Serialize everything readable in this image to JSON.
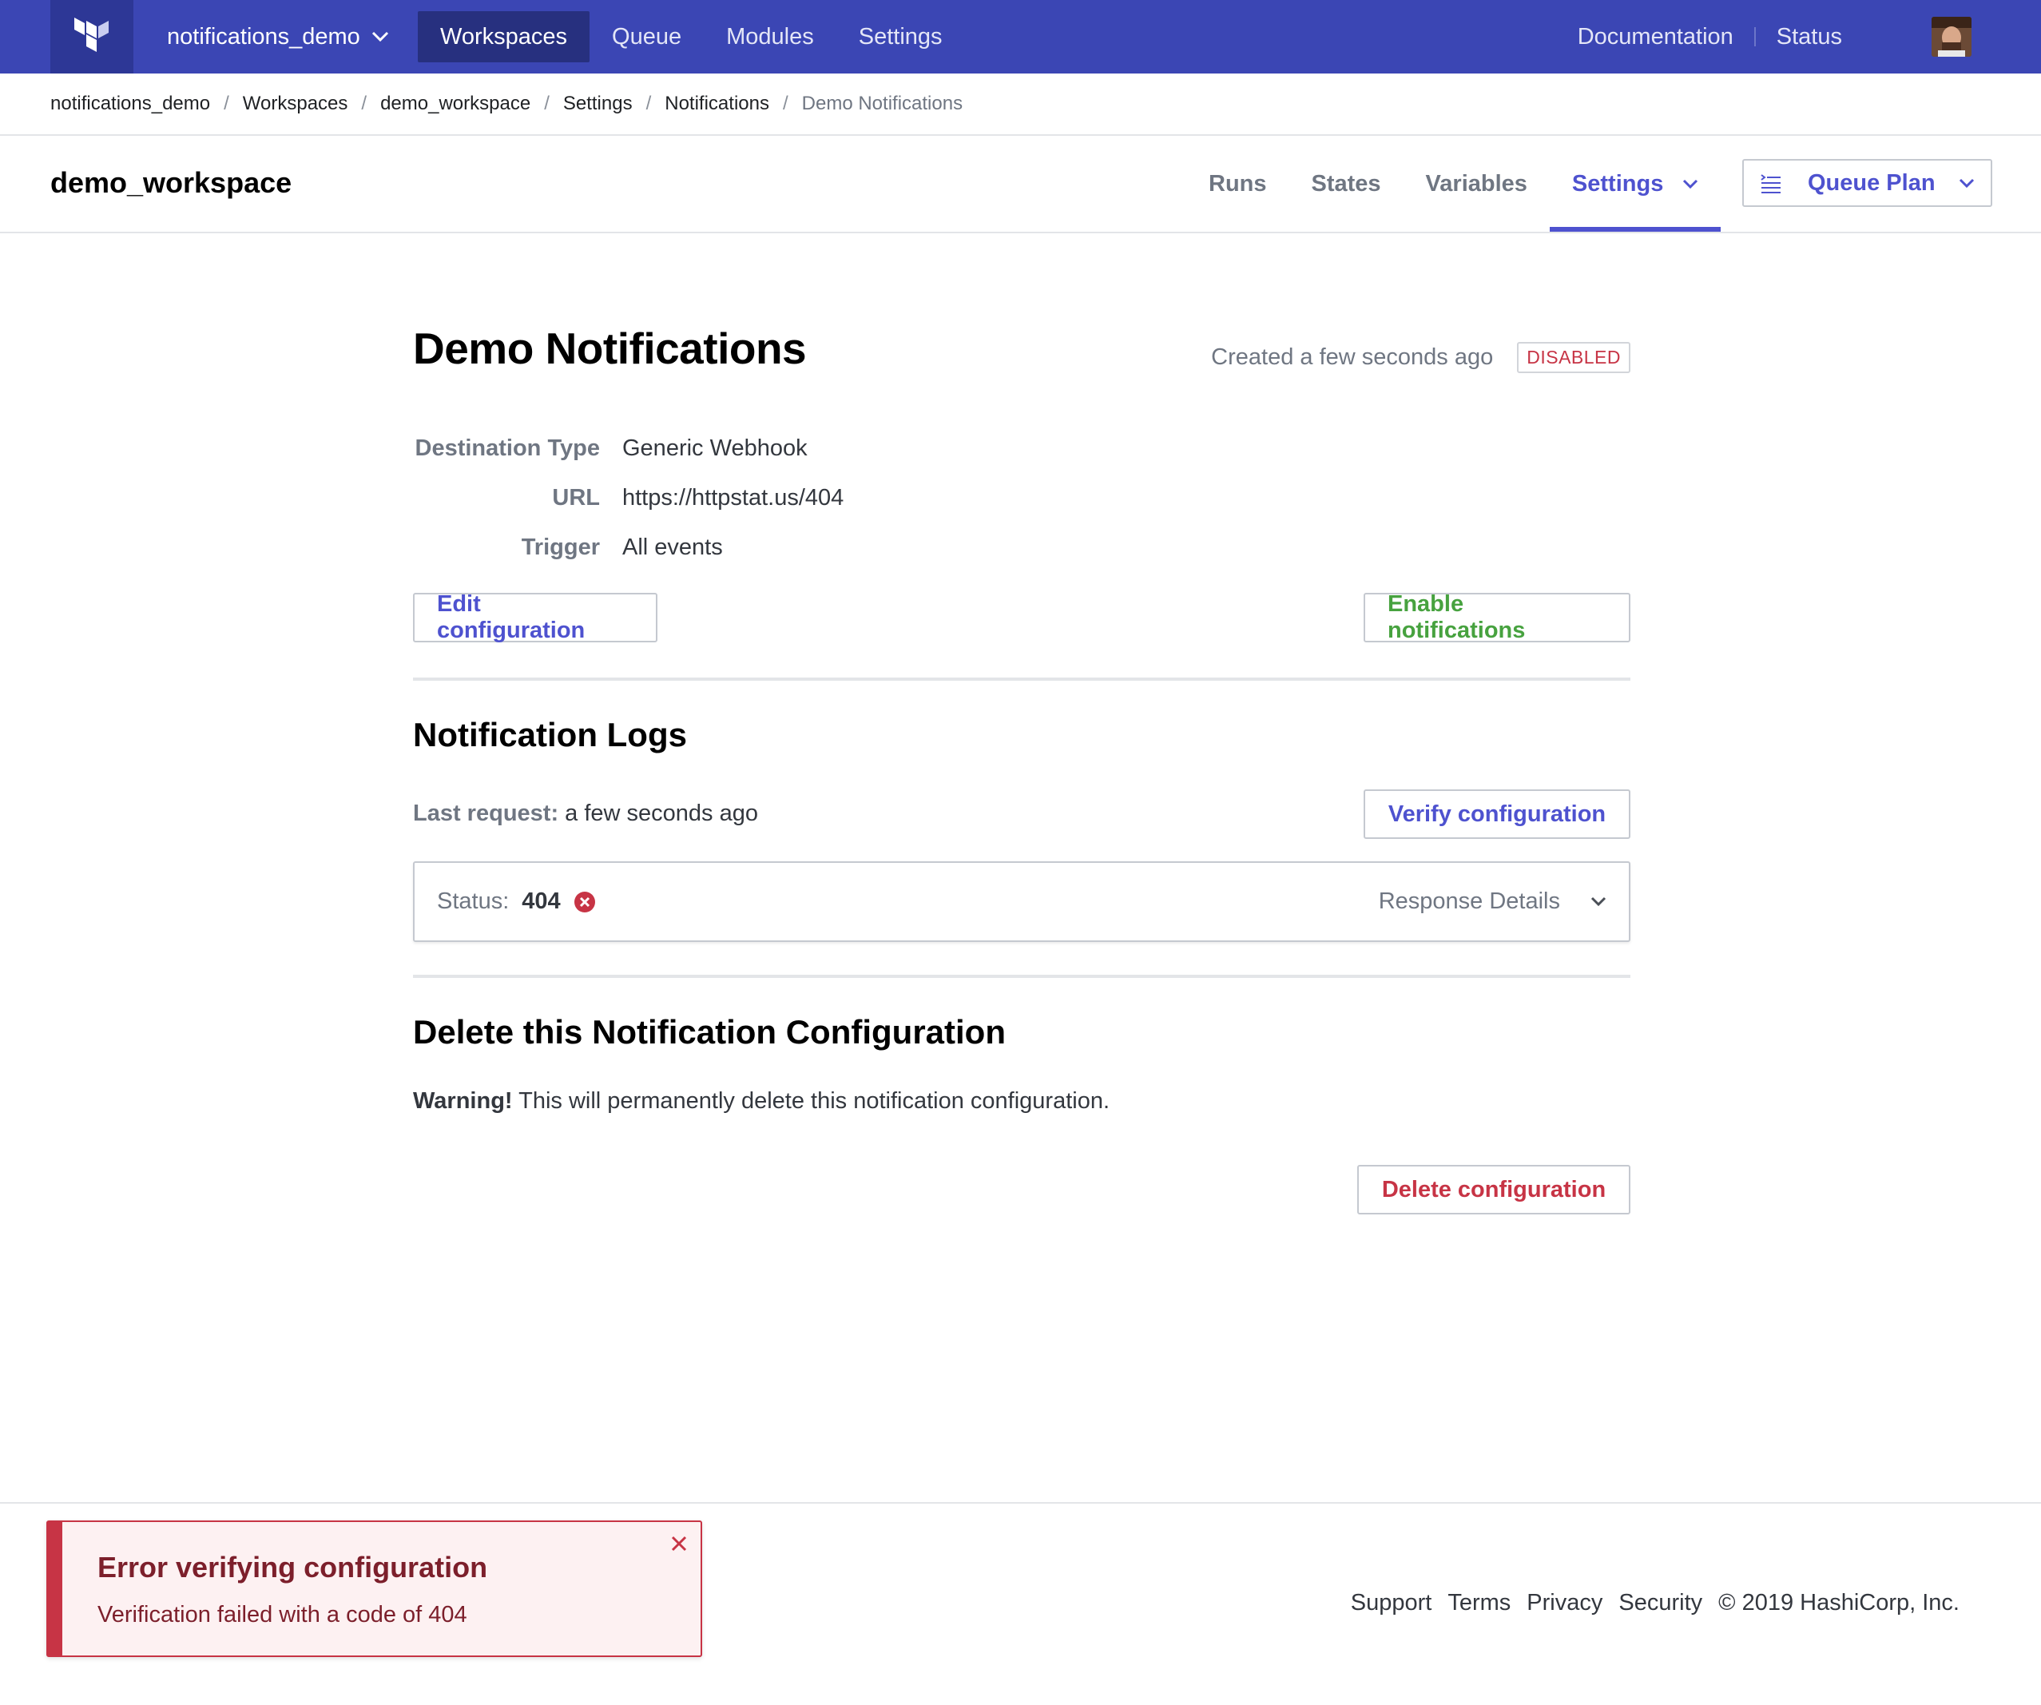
{
  "topnav": {
    "org": "notifications_demo",
    "links": [
      {
        "label": "Workspaces"
      },
      {
        "label": "Queue"
      },
      {
        "label": "Modules"
      },
      {
        "label": "Settings"
      }
    ],
    "documentation": "Documentation",
    "status": "Status"
  },
  "breadcrumb": [
    {
      "label": "notifications_demo"
    },
    {
      "label": "Workspaces"
    },
    {
      "label": "demo_workspace"
    },
    {
      "label": "Settings"
    },
    {
      "label": "Notifications"
    },
    {
      "label": "Demo Notifications"
    }
  ],
  "workspace": {
    "title": "demo_workspace",
    "tabs": [
      {
        "label": "Runs"
      },
      {
        "label": "States"
      },
      {
        "label": "Variables"
      },
      {
        "label": "Settings"
      }
    ],
    "queue_plan": "Queue Plan"
  },
  "notification": {
    "title": "Demo Notifications",
    "created": "Created a few seconds ago",
    "badge": "DISABLED",
    "details": [
      {
        "label": "Destination Type",
        "value": "Generic Webhook"
      },
      {
        "label": "URL",
        "value": "https://httpstat.us/404"
      },
      {
        "label": "Trigger",
        "value": "All events"
      }
    ],
    "edit_button": "Edit configuration",
    "enable_button": "Enable notifications"
  },
  "logs": {
    "title": "Notification Logs",
    "last_request_label": "Last request:",
    "last_request_value": "a few seconds ago",
    "verify_button": "Verify configuration",
    "status_label": "Status:",
    "status_code": "404",
    "response_details": "Response Details"
  },
  "delete": {
    "title": "Delete this Notification Configuration",
    "warning_label": "Warning!",
    "warning_text": "This will permanently delete this notification configuration.",
    "button": "Delete configuration"
  },
  "footer": {
    "links": [
      "Support",
      "Terms",
      "Privacy",
      "Security"
    ],
    "copyright": "© 2019 HashiCorp, Inc."
  },
  "toast": {
    "title": "Error verifying configuration",
    "message": "Verification failed with a code of 404"
  },
  "colors": {
    "nav_bg": "#3b46b4",
    "accent": "#4e52cf",
    "success": "#47a23f",
    "danger": "#c73445"
  },
  "icons": {
    "logo": "terraform-logo-icon",
    "org_chevron": "chevron-down-icon",
    "settings_chevron": "chevron-down-icon",
    "queue_plan": "terminal-list-icon",
    "status_error": "error-circle-icon",
    "toast_close": "close-icon"
  }
}
